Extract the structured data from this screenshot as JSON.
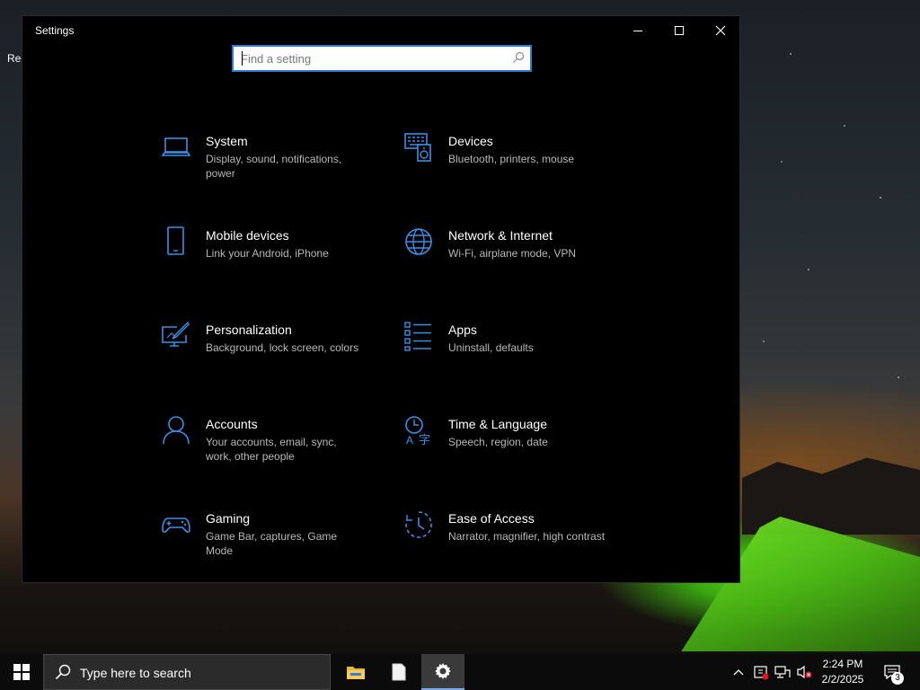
{
  "desktop": {
    "icon_label": "Rec"
  },
  "window": {
    "title": "Settings",
    "search": {
      "placeholder": "Find a setting",
      "value": ""
    },
    "accent": "#3a8fe6"
  },
  "categories": [
    {
      "icon": "laptop-icon",
      "name": "System",
      "desc": "Display, sound, notifications, power"
    },
    {
      "icon": "keyboard-speaker-icon",
      "name": "Devices",
      "desc": "Bluetooth, printers, mouse"
    },
    {
      "icon": "phone-icon",
      "name": "Mobile devices",
      "desc": "Link your Android, iPhone"
    },
    {
      "icon": "globe-icon",
      "name": "Network & Internet",
      "desc": "Wi-Fi, airplane mode, VPN"
    },
    {
      "icon": "paintbrush-monitor-icon",
      "name": "Personalization",
      "desc": "Background, lock screen, colors"
    },
    {
      "icon": "apps-list-icon",
      "name": "Apps",
      "desc": "Uninstall, defaults"
    },
    {
      "icon": "person-icon",
      "name": "Accounts",
      "desc": "Your accounts, email, sync, work, other people"
    },
    {
      "icon": "clock-language-icon",
      "name": "Time & Language",
      "desc": "Speech, region, date"
    },
    {
      "icon": "gamepad-icon",
      "name": "Gaming",
      "desc": "Game Bar, captures, Game Mode"
    },
    {
      "icon": "ease-of-access-icon",
      "name": "Ease of Access",
      "desc": "Narrator, magnifier, high contrast"
    }
  ],
  "taskbar": {
    "search_placeholder": "Type here to search",
    "time": "2:24 PM",
    "date": "2/2/2025",
    "notification_count": "3"
  }
}
